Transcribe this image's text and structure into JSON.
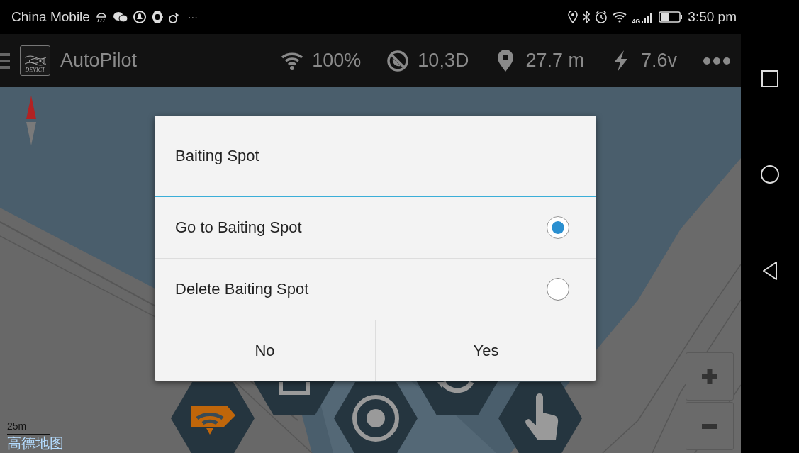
{
  "status_bar": {
    "carrier": "China Mobile",
    "more": "···",
    "network": "4G",
    "time": "3:50 pm"
  },
  "app_bar": {
    "logo_text": "DEVICT",
    "title": "AutoPilot",
    "stats": [
      {
        "kind": "wifi",
        "value": "100%"
      },
      {
        "kind": "gps",
        "value": "10,3D"
      },
      {
        "kind": "distance",
        "value": "27.7 m"
      },
      {
        "kind": "voltage",
        "value": "7.6v"
      }
    ]
  },
  "map": {
    "scale": "25m",
    "attribution": "高德地图",
    "tools": [
      {
        "kind": "wifi"
      },
      {
        "kind": "stop"
      },
      {
        "kind": "target"
      },
      {
        "kind": "undo"
      },
      {
        "kind": "hand"
      }
    ]
  },
  "dialog": {
    "title": "Baiting Spot",
    "options": [
      {
        "label": "Go to Baiting Spot",
        "selected": true
      },
      {
        "label": "Delete Baiting Spot",
        "selected": false
      }
    ],
    "buttons": [
      "No",
      "Yes"
    ]
  }
}
